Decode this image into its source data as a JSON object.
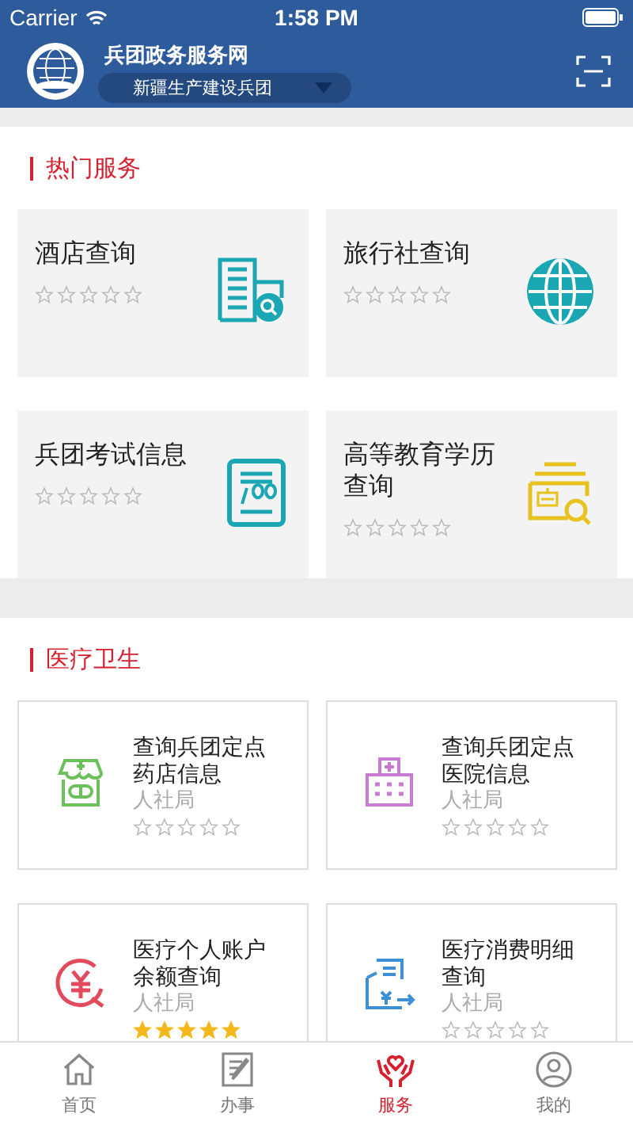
{
  "status_bar": {
    "carrier": "Carrier",
    "time": "1:58 PM"
  },
  "header": {
    "title": "兵团政务服务网",
    "region": "新疆生产建设兵团"
  },
  "sections": [
    {
      "title": "热门服务",
      "kind": "hot",
      "items": [
        {
          "title": "酒店查询",
          "stars": 0
        },
        {
          "title": "旅行社查询",
          "stars": 0
        },
        {
          "title": "兵团考试信息",
          "stars": 0
        },
        {
          "title": "高等教育学历查询",
          "stars": 0
        }
      ]
    },
    {
      "title": "医疗卫生",
      "kind": "list",
      "items": [
        {
          "title": "查询兵团定点药店信息",
          "source": "人社局",
          "stars": 0
        },
        {
          "title": "查询兵团定点医院信息",
          "source": "人社局",
          "stars": 0
        },
        {
          "title": "医疗个人账户余额查询",
          "source": "人社局",
          "stars": 5
        },
        {
          "title": "医疗消费明细查询",
          "source": "人社局",
          "stars": 0
        }
      ]
    }
  ],
  "tabs": [
    {
      "label": "首页",
      "selected": false
    },
    {
      "label": "办事",
      "selected": false
    },
    {
      "label": "服务",
      "selected": true
    },
    {
      "label": "我的",
      "selected": false
    }
  ]
}
